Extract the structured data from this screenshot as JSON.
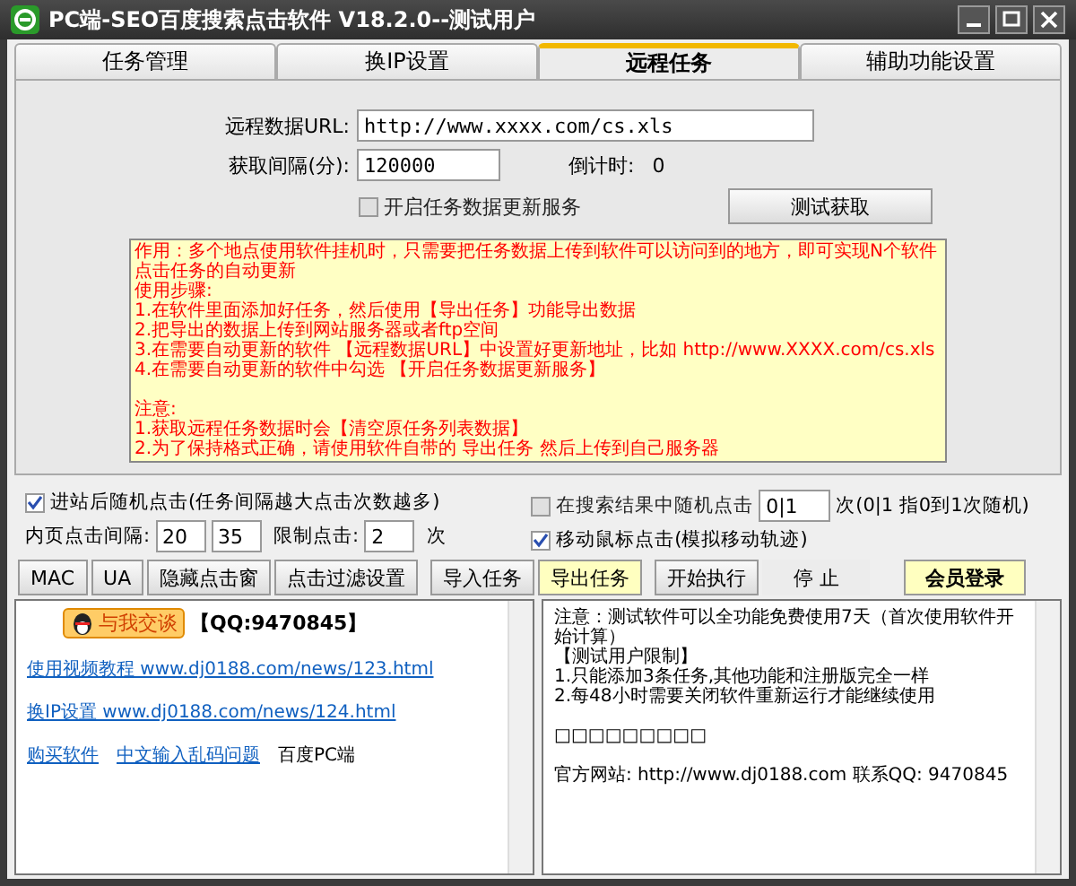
{
  "window": {
    "title": "PC端-SEO百度搜索点击软件 V18.2.0--测试用户"
  },
  "tabs": [
    {
      "label": "任务管理",
      "selected": false
    },
    {
      "label": "换IP设置",
      "selected": false
    },
    {
      "label": "远程任务",
      "selected": true
    },
    {
      "label": "辅助功能设置",
      "selected": false
    }
  ],
  "remote": {
    "url_label": "远程数据URL:",
    "url_value": "http://www.xxxx.com/cs.xls",
    "interval_label": "获取间隔(分):",
    "interval_value": "120000",
    "countdown_label": "倒计时:",
    "countdown_value": "0",
    "service": {
      "label": "开启任务数据更新服务",
      "checked": false
    },
    "test_button": "测试获取"
  },
  "notes": [
    [
      "作用：多个地点使用软件挂机时，只需要把任务数据上传到软件可以访问到的地方，即可实现N个软件点击任务的自动更新",
      "使用步骤:",
      "1.在软件里面添加好任务，然后使用【导出任务】功能导出数据",
      "2.把导出的数据上传到网站服务器或者ftp空间",
      "3.在需要自动更新的软件 【远程数据URL】中设置好更新地址，比如 http://www.XXXX.com/cs.xls",
      "4.在需要自动更新的软件中勾选 【开启任务数据更新服务】"
    ],
    [
      "注意:",
      "1.获取远程任务数据时会【清空原任务列表数据】",
      "2.为了保持格式正确，请使用软件自带的 导出任务  然后上传到自己服务器"
    ]
  ],
  "options": {
    "random_click": {
      "label": "进站后随机点击(任务间隔越大点击次数越多)",
      "checked": true
    },
    "inner_interval_label": "内页点击间隔:",
    "inner_min": "20",
    "inner_max": "35",
    "limit_label": "限制点击:",
    "limit_value": "2",
    "limit_unit": "次",
    "search_random": {
      "label": "在搜索结果中随机点击",
      "checked": false
    },
    "search_count": "0|1",
    "search_hint": "次(0|1 指0到1次随机)",
    "mouse_move": {
      "label": "移动鼠标点击(模拟移动轨迹)",
      "checked": true
    }
  },
  "button_groups": [
    [
      {
        "label": "MAC",
        "kind": "normal"
      },
      {
        "label": "UA",
        "kind": "normal"
      },
      {
        "label": "隐藏点击窗",
        "kind": "normal"
      },
      {
        "label": "点击过滤设置",
        "kind": "normal"
      }
    ],
    [
      {
        "label": "导入任务",
        "kind": "normal"
      },
      {
        "label": "导出任务",
        "kind": "highlight"
      }
    ],
    [
      {
        "label": "开始执行",
        "kind": "normal"
      },
      {
        "label": "停  止",
        "kind": "flat"
      }
    ],
    [
      {
        "label": "会员登录",
        "kind": "highlight"
      }
    ]
  ],
  "left_pane": {
    "chat_badge": "与我交谈",
    "qq": "【QQ:9470845】",
    "lines": [
      [
        {
          "text": "使用视频教程 www.dj0188.com/news/123.html",
          "kind": "link"
        }
      ],
      [
        {
          "text": "换IP设置 www.dj0188.com/news/124.html",
          "kind": "link"
        }
      ],
      [
        {
          "text": "购买软件",
          "kind": "link"
        },
        {
          "text": "中文输入乱码问题",
          "kind": "link"
        },
        {
          "text": "百度PC端",
          "kind": "text"
        }
      ]
    ]
  },
  "right_pane": {
    "groups": [
      [
        "注意：测试软件可以全功能免费使用7天（首次使用软件开始计算）",
        "【测试用户限制】",
        "1.只能添加3条任务,其他功能和注册版完全一样",
        "2.每48小时需要关闭软件重新运行才能继续使用"
      ],
      [
        "□□□□□□□□□"
      ],
      [
        "官方网站: http://www.dj0188.com 联系QQ: 9470845"
      ]
    ]
  }
}
